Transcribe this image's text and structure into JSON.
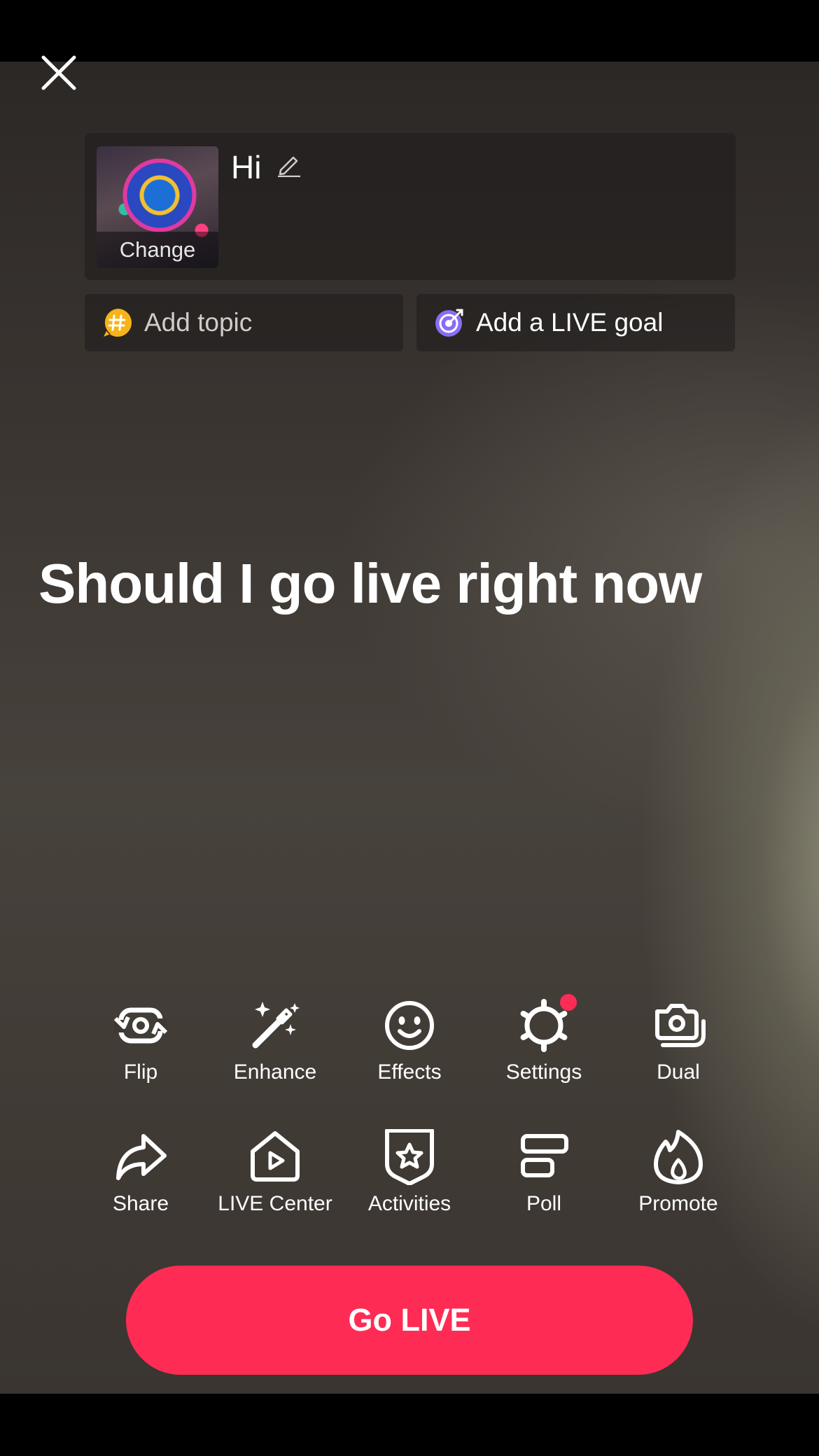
{
  "setup": {
    "title": "Hi",
    "cover_label": "Change",
    "topic_label": "Add topic",
    "goal_label": "Add a LIVE goal"
  },
  "caption": "Should I go live right now",
  "tools": [
    {
      "label": "Flip",
      "icon": "flip-camera-icon"
    },
    {
      "label": "Enhance",
      "icon": "magic-wand-icon"
    },
    {
      "label": "Effects",
      "icon": "smiley-face-icon"
    },
    {
      "label": "Settings",
      "icon": "gear-icon",
      "badge": true
    },
    {
      "label": "Dual",
      "icon": "dual-camera-icon"
    },
    {
      "label": "Share",
      "icon": "share-arrow-icon"
    },
    {
      "label": "LIVE Center",
      "icon": "live-center-house-icon"
    },
    {
      "label": "Activities",
      "icon": "shield-star-icon"
    },
    {
      "label": "Poll",
      "icon": "poll-bars-icon"
    },
    {
      "label": "Promote",
      "icon": "flame-icon"
    }
  ],
  "go_live_label": "Go LIVE",
  "colors": {
    "accent": "#fe2c55",
    "topic_icon": "#f7b319",
    "goal_icon": "#8b6cf5"
  }
}
